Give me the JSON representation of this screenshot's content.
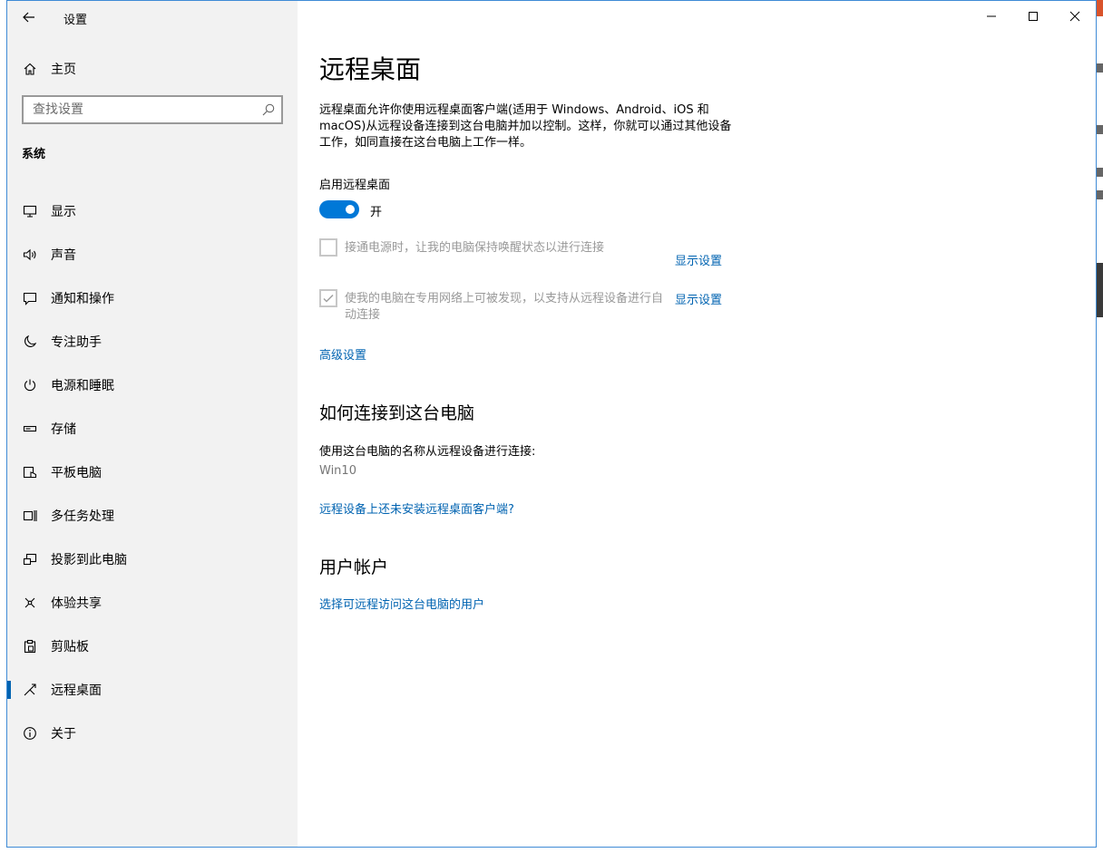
{
  "window": {
    "app_title": "设置",
    "controls": {
      "minimize": "minimize",
      "maximize": "maximize",
      "close": "close"
    }
  },
  "sidebar": {
    "home_label": "主页",
    "search_placeholder": "查找设置",
    "section_label": "系统",
    "items": [
      {
        "label": "显示",
        "icon": "monitor-icon"
      },
      {
        "label": "声音",
        "icon": "speaker-icon"
      },
      {
        "label": "通知和操作",
        "icon": "notification-icon"
      },
      {
        "label": "专注助手",
        "icon": "moon-icon"
      },
      {
        "label": "电源和睡眠",
        "icon": "power-icon"
      },
      {
        "label": "存储",
        "icon": "storage-icon"
      },
      {
        "label": "平板电脑",
        "icon": "tablet-icon"
      },
      {
        "label": "多任务处理",
        "icon": "multitask-icon"
      },
      {
        "label": "投影到此电脑",
        "icon": "project-icon"
      },
      {
        "label": "体验共享",
        "icon": "share-icon"
      },
      {
        "label": "剪贴板",
        "icon": "clipboard-icon"
      },
      {
        "label": "远程桌面",
        "icon": "remote-desktop-icon",
        "selected": true
      },
      {
        "label": "关于",
        "icon": "info-icon"
      }
    ]
  },
  "main": {
    "title": "远程桌面",
    "description": "远程桌面允许你使用远程桌面客户端(适用于 Windows、Android、iOS 和 macOS)从远程设备连接到这台电脑并加以控制。这样，你就可以通过其他设备工作，如同直接在这台电脑上工作一样。",
    "enable_label": "启用远程桌面",
    "toggle_state": "开",
    "toggle_on": true,
    "options": [
      {
        "text": "接通电源时，让我的电脑保持唤醒状态以进行连接",
        "checked": false,
        "link": "显示设置"
      },
      {
        "text": "使我的电脑在专用网络上可被发现，以支持从远程设备进行自动连接",
        "checked": true,
        "link": "显示设置"
      }
    ],
    "advanced_link": "高级设置",
    "connect_heading": "如何连接到这台电脑",
    "connect_text": "使用这台电脑的名称从远程设备进行连接:",
    "pc_name": "Win10",
    "client_link": "远程设备上还未安装远程桌面客户端?",
    "accounts_heading": "用户帐户",
    "accounts_link": "选择可远程访问这台电脑的用户"
  },
  "colors": {
    "accent": "#0078d7",
    "link": "#0063b1",
    "sidebar_bg": "#f2f2f2",
    "window_border": "#3f8bd6"
  }
}
